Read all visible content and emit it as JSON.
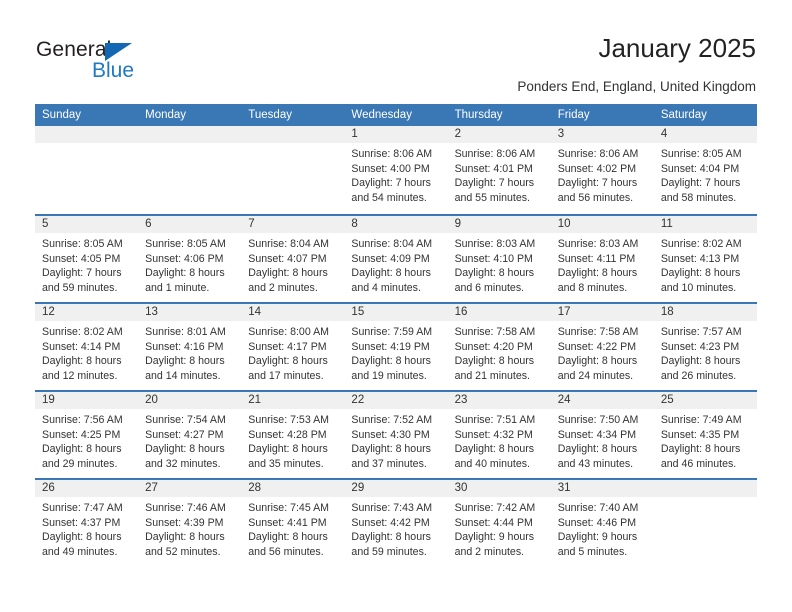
{
  "brand": {
    "name_part1": "General",
    "name_part2": "Blue",
    "triangle_icon": "triangle-icon",
    "accent_color": "#1268b3",
    "blue_text_color": "#1e7ac4"
  },
  "header": {
    "title": "January 2025",
    "subtitle": "Ponders End, England, United Kingdom",
    "header_bg_color": "#3a77b5",
    "header_text_color": "#ffffff"
  },
  "weekday_headers": [
    "Sunday",
    "Monday",
    "Tuesday",
    "Wednesday",
    "Thursday",
    "Friday",
    "Saturday"
  ],
  "weeks": [
    {
      "days": [
        {
          "num": "",
          "empty": true,
          "sunrise": "",
          "sunset": "",
          "daylight_line1": "",
          "daylight_line2": ""
        },
        {
          "num": "",
          "empty": true,
          "sunrise": "",
          "sunset": "",
          "daylight_line1": "",
          "daylight_line2": ""
        },
        {
          "num": "",
          "empty": true,
          "sunrise": "",
          "sunset": "",
          "daylight_line1": "",
          "daylight_line2": ""
        },
        {
          "num": "1",
          "empty": false,
          "sunrise": "Sunrise: 8:06 AM",
          "sunset": "Sunset: 4:00 PM",
          "daylight_line1": "Daylight: 7 hours",
          "daylight_line2": "and 54 minutes."
        },
        {
          "num": "2",
          "empty": false,
          "sunrise": "Sunrise: 8:06 AM",
          "sunset": "Sunset: 4:01 PM",
          "daylight_line1": "Daylight: 7 hours",
          "daylight_line2": "and 55 minutes."
        },
        {
          "num": "3",
          "empty": false,
          "sunrise": "Sunrise: 8:06 AM",
          "sunset": "Sunset: 4:02 PM",
          "daylight_line1": "Daylight: 7 hours",
          "daylight_line2": "and 56 minutes."
        },
        {
          "num": "4",
          "empty": false,
          "sunrise": "Sunrise: 8:05 AM",
          "sunset": "Sunset: 4:04 PM",
          "daylight_line1": "Daylight: 7 hours",
          "daylight_line2": "and 58 minutes."
        }
      ]
    },
    {
      "days": [
        {
          "num": "5",
          "empty": false,
          "sunrise": "Sunrise: 8:05 AM",
          "sunset": "Sunset: 4:05 PM",
          "daylight_line1": "Daylight: 7 hours",
          "daylight_line2": "and 59 minutes."
        },
        {
          "num": "6",
          "empty": false,
          "sunrise": "Sunrise: 8:05 AM",
          "sunset": "Sunset: 4:06 PM",
          "daylight_line1": "Daylight: 8 hours",
          "daylight_line2": "and 1 minute."
        },
        {
          "num": "7",
          "empty": false,
          "sunrise": "Sunrise: 8:04 AM",
          "sunset": "Sunset: 4:07 PM",
          "daylight_line1": "Daylight: 8 hours",
          "daylight_line2": "and 2 minutes."
        },
        {
          "num": "8",
          "empty": false,
          "sunrise": "Sunrise: 8:04 AM",
          "sunset": "Sunset: 4:09 PM",
          "daylight_line1": "Daylight: 8 hours",
          "daylight_line2": "and 4 minutes."
        },
        {
          "num": "9",
          "empty": false,
          "sunrise": "Sunrise: 8:03 AM",
          "sunset": "Sunset: 4:10 PM",
          "daylight_line1": "Daylight: 8 hours",
          "daylight_line2": "and 6 minutes."
        },
        {
          "num": "10",
          "empty": false,
          "sunrise": "Sunrise: 8:03 AM",
          "sunset": "Sunset: 4:11 PM",
          "daylight_line1": "Daylight: 8 hours",
          "daylight_line2": "and 8 minutes."
        },
        {
          "num": "11",
          "empty": false,
          "sunrise": "Sunrise: 8:02 AM",
          "sunset": "Sunset: 4:13 PM",
          "daylight_line1": "Daylight: 8 hours",
          "daylight_line2": "and 10 minutes."
        }
      ]
    },
    {
      "days": [
        {
          "num": "12",
          "empty": false,
          "sunrise": "Sunrise: 8:02 AM",
          "sunset": "Sunset: 4:14 PM",
          "daylight_line1": "Daylight: 8 hours",
          "daylight_line2": "and 12 minutes."
        },
        {
          "num": "13",
          "empty": false,
          "sunrise": "Sunrise: 8:01 AM",
          "sunset": "Sunset: 4:16 PM",
          "daylight_line1": "Daylight: 8 hours",
          "daylight_line2": "and 14 minutes."
        },
        {
          "num": "14",
          "empty": false,
          "sunrise": "Sunrise: 8:00 AM",
          "sunset": "Sunset: 4:17 PM",
          "daylight_line1": "Daylight: 8 hours",
          "daylight_line2": "and 17 minutes."
        },
        {
          "num": "15",
          "empty": false,
          "sunrise": "Sunrise: 7:59 AM",
          "sunset": "Sunset: 4:19 PM",
          "daylight_line1": "Daylight: 8 hours",
          "daylight_line2": "and 19 minutes."
        },
        {
          "num": "16",
          "empty": false,
          "sunrise": "Sunrise: 7:58 AM",
          "sunset": "Sunset: 4:20 PM",
          "daylight_line1": "Daylight: 8 hours",
          "daylight_line2": "and 21 minutes."
        },
        {
          "num": "17",
          "empty": false,
          "sunrise": "Sunrise: 7:58 AM",
          "sunset": "Sunset: 4:22 PM",
          "daylight_line1": "Daylight: 8 hours",
          "daylight_line2": "and 24 minutes."
        },
        {
          "num": "18",
          "empty": false,
          "sunrise": "Sunrise: 7:57 AM",
          "sunset": "Sunset: 4:23 PM",
          "daylight_line1": "Daylight: 8 hours",
          "daylight_line2": "and 26 minutes."
        }
      ]
    },
    {
      "days": [
        {
          "num": "19",
          "empty": false,
          "sunrise": "Sunrise: 7:56 AM",
          "sunset": "Sunset: 4:25 PM",
          "daylight_line1": "Daylight: 8 hours",
          "daylight_line2": "and 29 minutes."
        },
        {
          "num": "20",
          "empty": false,
          "sunrise": "Sunrise: 7:54 AM",
          "sunset": "Sunset: 4:27 PM",
          "daylight_line1": "Daylight: 8 hours",
          "daylight_line2": "and 32 minutes."
        },
        {
          "num": "21",
          "empty": false,
          "sunrise": "Sunrise: 7:53 AM",
          "sunset": "Sunset: 4:28 PM",
          "daylight_line1": "Daylight: 8 hours",
          "daylight_line2": "and 35 minutes."
        },
        {
          "num": "22",
          "empty": false,
          "sunrise": "Sunrise: 7:52 AM",
          "sunset": "Sunset: 4:30 PM",
          "daylight_line1": "Daylight: 8 hours",
          "daylight_line2": "and 37 minutes."
        },
        {
          "num": "23",
          "empty": false,
          "sunrise": "Sunrise: 7:51 AM",
          "sunset": "Sunset: 4:32 PM",
          "daylight_line1": "Daylight: 8 hours",
          "daylight_line2": "and 40 minutes."
        },
        {
          "num": "24",
          "empty": false,
          "sunrise": "Sunrise: 7:50 AM",
          "sunset": "Sunset: 4:34 PM",
          "daylight_line1": "Daylight: 8 hours",
          "daylight_line2": "and 43 minutes."
        },
        {
          "num": "25",
          "empty": false,
          "sunrise": "Sunrise: 7:49 AM",
          "sunset": "Sunset: 4:35 PM",
          "daylight_line1": "Daylight: 8 hours",
          "daylight_line2": "and 46 minutes."
        }
      ]
    },
    {
      "days": [
        {
          "num": "26",
          "empty": false,
          "sunrise": "Sunrise: 7:47 AM",
          "sunset": "Sunset: 4:37 PM",
          "daylight_line1": "Daylight: 8 hours",
          "daylight_line2": "and 49 minutes."
        },
        {
          "num": "27",
          "empty": false,
          "sunrise": "Sunrise: 7:46 AM",
          "sunset": "Sunset: 4:39 PM",
          "daylight_line1": "Daylight: 8 hours",
          "daylight_line2": "and 52 minutes."
        },
        {
          "num": "28",
          "empty": false,
          "sunrise": "Sunrise: 7:45 AM",
          "sunset": "Sunset: 4:41 PM",
          "daylight_line1": "Daylight: 8 hours",
          "daylight_line2": "and 56 minutes."
        },
        {
          "num": "29",
          "empty": false,
          "sunrise": "Sunrise: 7:43 AM",
          "sunset": "Sunset: 4:42 PM",
          "daylight_line1": "Daylight: 8 hours",
          "daylight_line2": "and 59 minutes."
        },
        {
          "num": "30",
          "empty": false,
          "sunrise": "Sunrise: 7:42 AM",
          "sunset": "Sunset: 4:44 PM",
          "daylight_line1": "Daylight: 9 hours",
          "daylight_line2": "and 2 minutes."
        },
        {
          "num": "31",
          "empty": false,
          "sunrise": "Sunrise: 7:40 AM",
          "sunset": "Sunset: 4:46 PM",
          "daylight_line1": "Daylight: 9 hours",
          "daylight_line2": "and 5 minutes."
        },
        {
          "num": "",
          "empty": true,
          "sunrise": "",
          "sunset": "",
          "daylight_line1": "",
          "daylight_line2": ""
        }
      ]
    }
  ]
}
